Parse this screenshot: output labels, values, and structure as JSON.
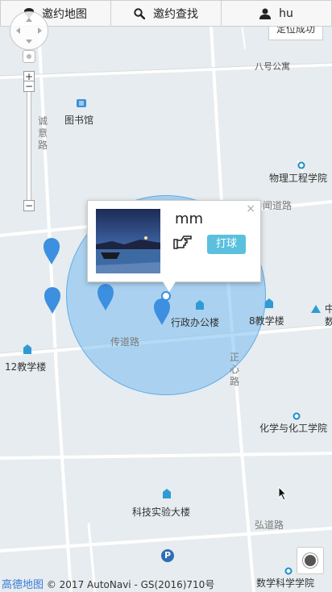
{
  "topbar": {
    "map_label": "邀约地图",
    "search_label": "邀约查找",
    "user_label": "hu"
  },
  "map": {
    "locate_tip": "定位成功",
    "labels": {
      "bagong": "八号公寓",
      "library": "图书馆",
      "physics": "物理工程学院",
      "admin": "行政办公楼",
      "bldg8": "8教学楼",
      "bldg12": "12教学楼",
      "chem": "化学与化工学院",
      "tech": "科技实验大楼",
      "math": "数学科学学院",
      "edge_zhong": "中",
      "edge_shu": "数"
    },
    "roads": {
      "chengyi": "诚意路",
      "wendao": "闻道路",
      "chuandao": "传道路",
      "zhengxin": "正心路",
      "hongdao": "弘道路"
    },
    "attribution_brand": "高德地图",
    "attribution_text": "© 2017 AutoNavi - GS(2016)710号"
  },
  "popup": {
    "name": "mm",
    "action_label": "打球",
    "close_glyph": "×"
  }
}
